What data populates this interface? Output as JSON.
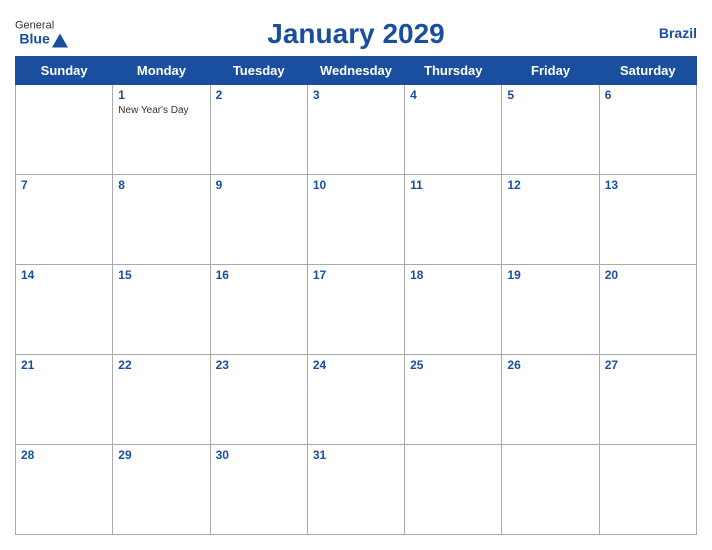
{
  "header": {
    "logo_general": "General",
    "logo_blue": "Blue",
    "title": "January 2029",
    "country": "Brazil"
  },
  "days_of_week": [
    "Sunday",
    "Monday",
    "Tuesday",
    "Wednesday",
    "Thursday",
    "Friday",
    "Saturday"
  ],
  "weeks": [
    [
      {
        "day": "",
        "empty": true
      },
      {
        "day": "1",
        "holiday": "New Year's Day"
      },
      {
        "day": "2"
      },
      {
        "day": "3"
      },
      {
        "day": "4"
      },
      {
        "day": "5"
      },
      {
        "day": "6"
      }
    ],
    [
      {
        "day": "7"
      },
      {
        "day": "8"
      },
      {
        "day": "9"
      },
      {
        "day": "10"
      },
      {
        "day": "11"
      },
      {
        "day": "12"
      },
      {
        "day": "13"
      }
    ],
    [
      {
        "day": "14"
      },
      {
        "day": "15"
      },
      {
        "day": "16"
      },
      {
        "day": "17"
      },
      {
        "day": "18"
      },
      {
        "day": "19"
      },
      {
        "day": "20"
      }
    ],
    [
      {
        "day": "21"
      },
      {
        "day": "22"
      },
      {
        "day": "23"
      },
      {
        "day": "24"
      },
      {
        "day": "25"
      },
      {
        "day": "26"
      },
      {
        "day": "27"
      }
    ],
    [
      {
        "day": "28"
      },
      {
        "day": "29"
      },
      {
        "day": "30"
      },
      {
        "day": "31"
      },
      {
        "day": "",
        "empty": true
      },
      {
        "day": "",
        "empty": true
      },
      {
        "day": "",
        "empty": true
      }
    ]
  ]
}
